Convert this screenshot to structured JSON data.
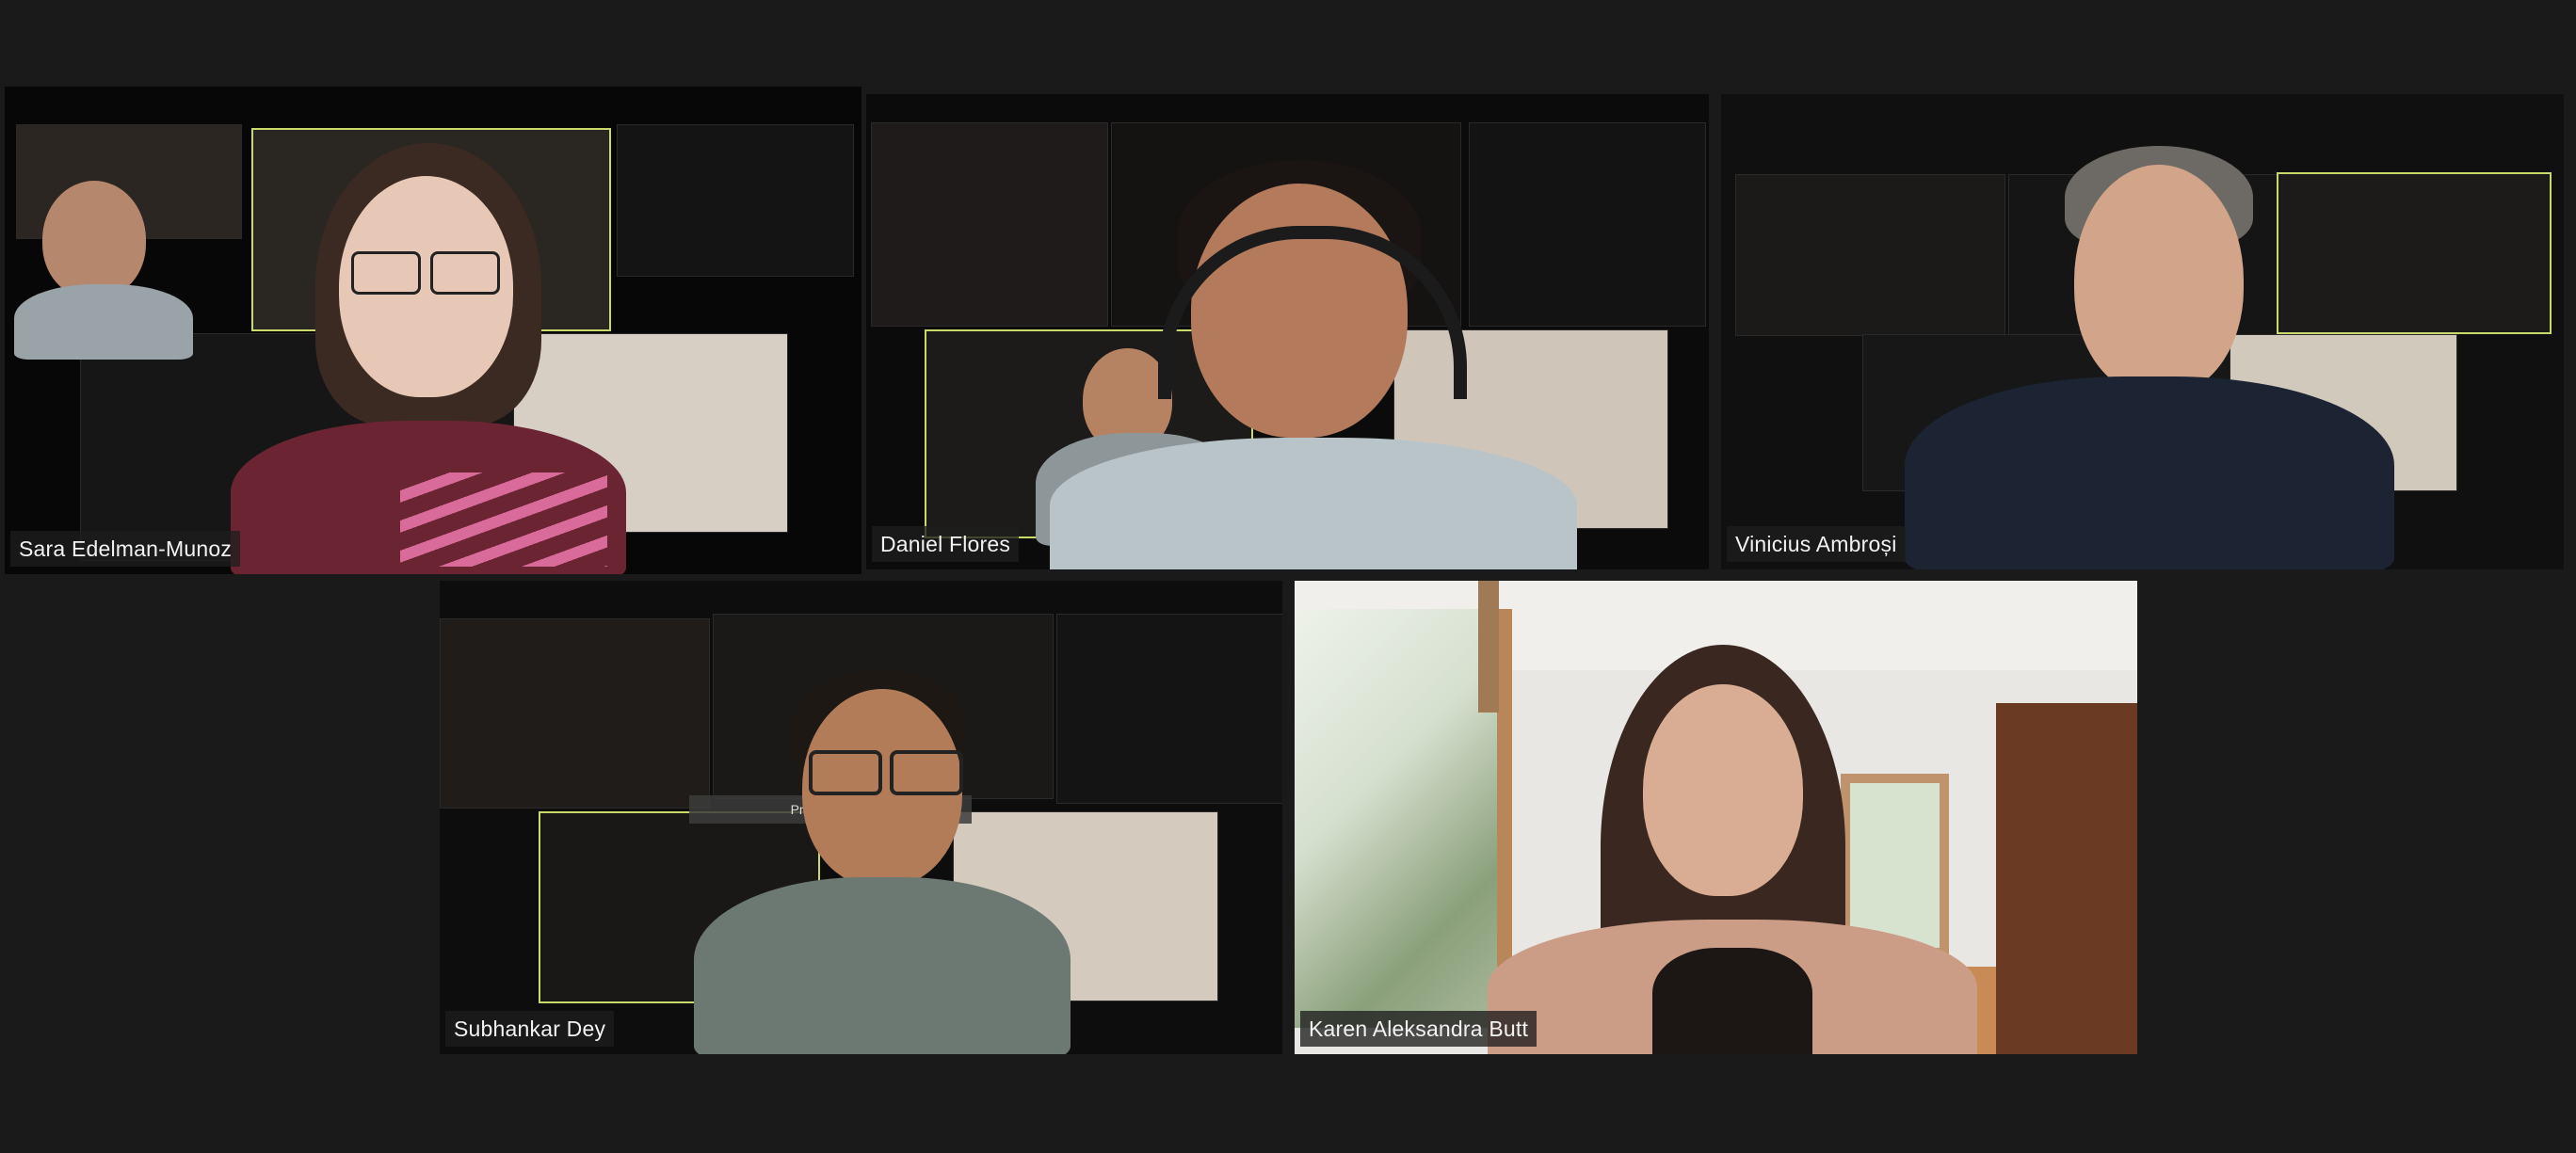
{
  "meeting": {
    "view": "gallery",
    "active_speaker_color": "#d9ef6a"
  },
  "participants": [
    {
      "name": "Sara Edelman-Munoz",
      "active": true
    },
    {
      "name": "Daniel Flores",
      "active": false
    },
    {
      "name": "Vinicius Ambroși",
      "active": false
    },
    {
      "name": "Subhankar Dey",
      "active": false
    },
    {
      "name": "Karen Aleksandra Butt",
      "active": false
    }
  ],
  "overlay_notice": "Press ESC or"
}
